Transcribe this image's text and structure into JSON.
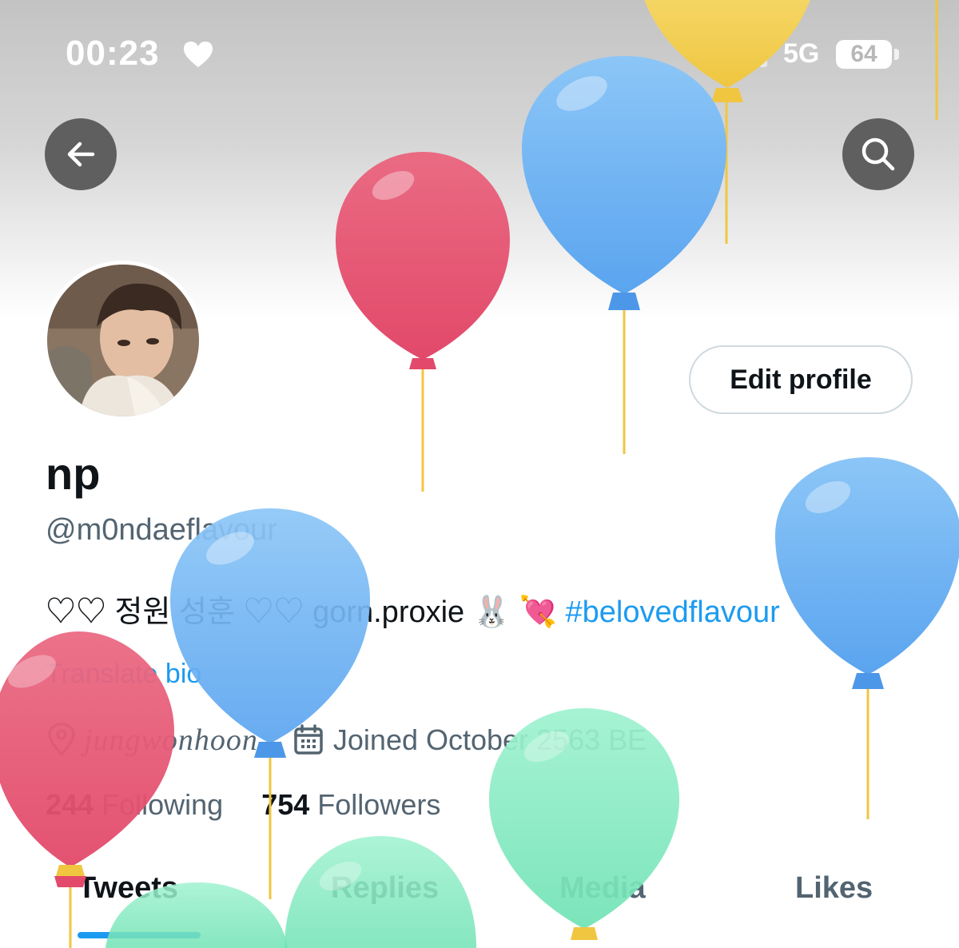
{
  "status_bar": {
    "time": "00:23",
    "network": "5G",
    "battery": "64"
  },
  "profile": {
    "display_name": "np",
    "handle": "@m0ndaeflavour",
    "bio_text": "♡♡ 정원 성훈 ♡♡ gorn.proxie 🐰 💘",
    "bio_hashtag": "#belovedflavour",
    "translate_label": "Translate bio",
    "location": "jungwonhoon",
    "joined": "Joined October 2563 BE",
    "following_count": "244",
    "following_label": "Following",
    "followers_count": "754",
    "followers_label": "Followers",
    "edit_button": "Edit profile"
  },
  "tabs": [
    {
      "label": "Tweets",
      "active": true
    },
    {
      "label": "Replies",
      "active": false
    },
    {
      "label": "Media",
      "active": false
    },
    {
      "label": "Likes",
      "active": false
    }
  ],
  "icons": {
    "back": "arrow-left-icon",
    "search": "search-icon",
    "location": "location-pin-icon",
    "calendar": "calendar-icon",
    "status_heart": "heart-icon",
    "signal": "signal-icon"
  },
  "colors": {
    "accent": "#1d9bf0",
    "balloon_red": "#e5536f",
    "balloon_blue": "#6fb2f2",
    "balloon_green": "#7fe8c0",
    "balloon_yellow": "#f3cf55"
  }
}
